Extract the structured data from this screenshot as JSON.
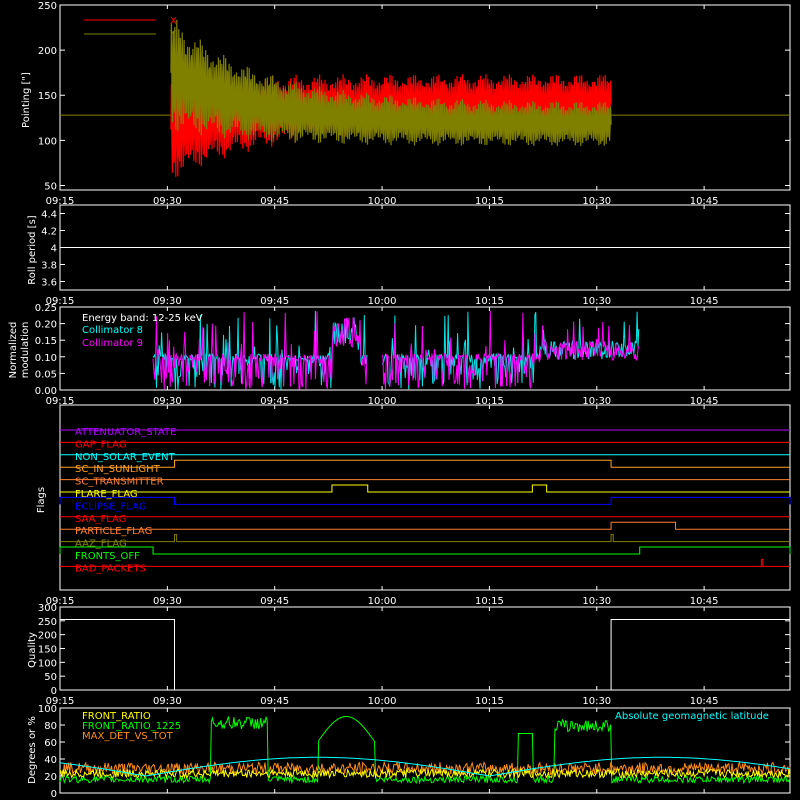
{
  "time_ticks": [
    "09:15",
    "09:30",
    "09:45",
    "10:00",
    "10:15",
    "10:30",
    "10:45"
  ],
  "chart_data": [
    {
      "type": "line",
      "id": "pointing",
      "ylabel": "Pointing [\"]",
      "ylim": [
        45,
        250
      ],
      "yticks": [
        50,
        100,
        150,
        200,
        250
      ],
      "series": [
        {
          "name": "X",
          "color": "#ff0000",
          "values": "oscillating envelope 09:30-10:32; starts ~55-170, converges to ~110-175"
        },
        {
          "name": "Y",
          "color": "#808000",
          "values": "oscillating envelope 09:30-10:32; starts ~110-240, converges to ~95-145"
        }
      ],
      "baseline_value": 128
    },
    {
      "type": "line",
      "id": "roll",
      "ylabel": "Roll period [s]",
      "ylim": [
        3.5,
        4.5
      ],
      "yticks": [
        3.6,
        3.8,
        4.0,
        4.2,
        4.4
      ],
      "series": [
        {
          "name": "",
          "color": "#ffffff",
          "value": 4.0
        }
      ]
    },
    {
      "type": "line",
      "id": "modulation",
      "ylabel_lines": [
        "Normalized",
        "modulation"
      ],
      "ylim": [
        0.0,
        0.25
      ],
      "yticks": [
        0.0,
        0.05,
        0.1,
        0.15,
        0.2,
        0.25
      ],
      "ytick_labels": [
        "0.00",
        "0.05",
        "0.10",
        "0.15",
        "0.20",
        "0.25"
      ],
      "legend_title": "Energy band: 12-25 keV",
      "series": [
        {
          "name": "Collimator 8",
          "color": "#00ffff"
        },
        {
          "name": "Collimator 9",
          "color": "#ff00ff"
        }
      ]
    },
    {
      "type": "line",
      "id": "flags",
      "ylabel": "Flags",
      "flags": [
        {
          "name": "ATTENUATOR_STATE",
          "color": "#b000ff",
          "high": []
        },
        {
          "name": "GAP_FLAG",
          "color": "#ff0000",
          "high": []
        },
        {
          "name": "NON_SOLAR_EVENT",
          "color": "#00ffff",
          "high": []
        },
        {
          "name": "SC_IN_SUNLIGHT",
          "color": "#ffa020",
          "high": [
            [
              "09:31",
              "10:32"
            ]
          ]
        },
        {
          "name": "SC_TRANSMITTER",
          "color": "#ff7f30",
          "high": []
        },
        {
          "name": "FLARE_FLAG",
          "color": "#ffff00",
          "high": [
            [
              "09:53",
              "09:58"
            ],
            [
              "10:21",
              "10:23"
            ]
          ]
        },
        {
          "name": "ECLIPSE_FLAG",
          "color": "#0000ff",
          "high": [
            [
              "09:15",
              "09:31"
            ],
            [
              "10:32",
              "10:57"
            ]
          ]
        },
        {
          "name": "SAA_FLAG",
          "color": "#ff0000",
          "high": []
        },
        {
          "name": "PARTICLE_FLAG",
          "color": "#ff7f30",
          "high": [
            [
              "10:32",
              "10:41"
            ]
          ]
        },
        {
          "name": "AAZ_FLAG",
          "color": "#808000",
          "high": [
            [
              "09:31",
              "09:31.3"
            ],
            [
              "10:32",
              "10:32.3"
            ]
          ]
        },
        {
          "name": "FRONTS_OFF",
          "color": "#00ff00",
          "high": [
            [
              "09:15",
              "09:28"
            ],
            [
              "10:36",
              "10:57"
            ]
          ]
        },
        {
          "name": "BAD_PACKETS",
          "color": "#ff0000",
          "high": [
            [
              "10:53",
              "10:53.2"
            ]
          ]
        }
      ]
    },
    {
      "type": "line",
      "id": "quality",
      "ylabel": "Quality",
      "ylim": [
        0,
        300
      ],
      "yticks": [
        0,
        50,
        100,
        150,
        200,
        250,
        300
      ],
      "series": [
        {
          "name": "",
          "color": "#ffffff",
          "segments": [
            [
              "09:15",
              "09:31",
              255
            ],
            [
              "09:31",
              "10:32",
              0
            ],
            [
              "10:32",
              "10:57",
              255
            ]
          ]
        }
      ]
    },
    {
      "type": "line",
      "id": "ratios",
      "ylabel": "Degrees or %",
      "ylim": [
        0,
        100
      ],
      "yticks": [
        0,
        20,
        40,
        60,
        80,
        100
      ],
      "series": [
        {
          "name": "FRONT_RATIO",
          "color": "#ffff00"
        },
        {
          "name": "FRONT_RATIO_1225",
          "color": "#00ff00"
        },
        {
          "name": "MAX_DET_VS_TOT",
          "color": "#ff8c1a"
        },
        {
          "name": "Absolute geomagnetic latitude",
          "color": "#00ffff"
        }
      ]
    }
  ]
}
